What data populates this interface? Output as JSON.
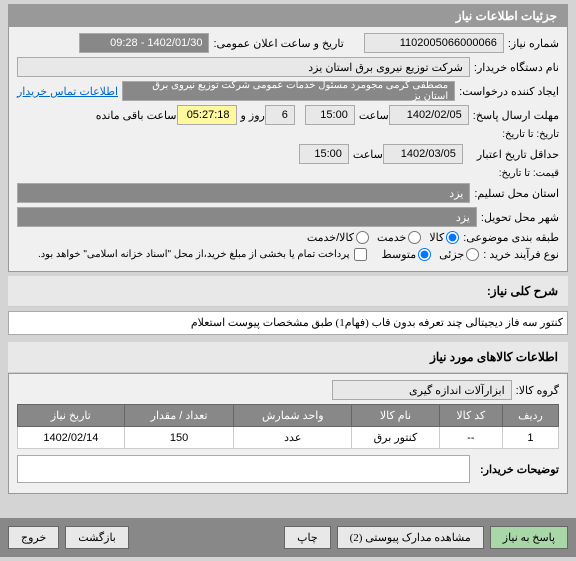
{
  "panel1_title": "جزئیات اطلاعات نیاز",
  "need_number_label": "شماره نیاز:",
  "need_number": "1102005066000066",
  "announce_date_label": "تاریخ و ساعت اعلان عمومی:",
  "announce_date": "1402/01/30 - 09:28",
  "buyer_label": "نام دستگاه خریدار:",
  "buyer": "شرکت توزیع نیروی برق استان یزد",
  "creator_label": "ایجاد کننده درخواست:",
  "creator": "مصطفی کرمی مجومرد مسئول خدمات عمومی شرکت توزیع نیروی برق استان یز",
  "contact_link": "اطلاعات تماس خریدار",
  "deadline_label": "مهلت ارسال پاسخ:",
  "deadline_date": "1402/02/05",
  "time_label": "ساعت",
  "deadline_time": "15:00",
  "day_label": "روز و",
  "days": "6",
  "remain_time": "05:27:18",
  "remain_label": "ساعت باقی مانده",
  "until_label": "تاریخ: تا تاریخ:",
  "min_valid_label": "حداقل تاریخ اعتبار",
  "min_valid_until": "قیمت: تا تاریخ:",
  "min_valid_date": "1402/03/05",
  "min_valid_time": "15:00",
  "location_label": "استان محل تسلیم:",
  "location": "یزد",
  "city_label": "شهر محل تحویل:",
  "city": "یزد",
  "category_label": "طبقه بندی موضوعی:",
  "goods_label": "کالا",
  "service_label": "خدمت",
  "both_label": "کالا/خدمت",
  "purchase_type_label": "نوع فرآیند خرید :",
  "minor_label": "جزئی",
  "medium_label": "متوسط",
  "payment_note": "پرداخت تمام یا بخشی از مبلغ خرید،از محل \"اسناد خزانه اسلامی\" خواهد بود.",
  "summary_label": "شرح کلی نیاز:",
  "summary_text": "کنتور سه فاز دیجیتالی چند تعرفه بدون قاب (فهام1) طبق مشخصات پیوست استعلام",
  "goods_info_title": "اطلاعات کالاهای مورد نیاز",
  "group_label": "گروه کالا:",
  "group_value": "ابزارآلات اندازه گیری",
  "th_row": "ردیف",
  "th_code": "کد کالا",
  "th_name": "نام کالا",
  "th_unit": "واحد شمارش",
  "th_qty": "تعداد / مقدار",
  "th_date": "تاریخ نیاز",
  "row1_num": "1",
  "row1_code": "--",
  "row1_name": "کنتور برق",
  "row1_unit": "عدد",
  "row1_qty": "150",
  "row1_date": "1402/02/14",
  "notes_label": "توضیحات خریدار:",
  "btn_respond": "پاسخ به نیاز",
  "btn_attach": "مشاهده مدارک پیوستی (2)",
  "btn_print": "چاپ",
  "btn_back": "بازگشت",
  "btn_exit": "خروج"
}
